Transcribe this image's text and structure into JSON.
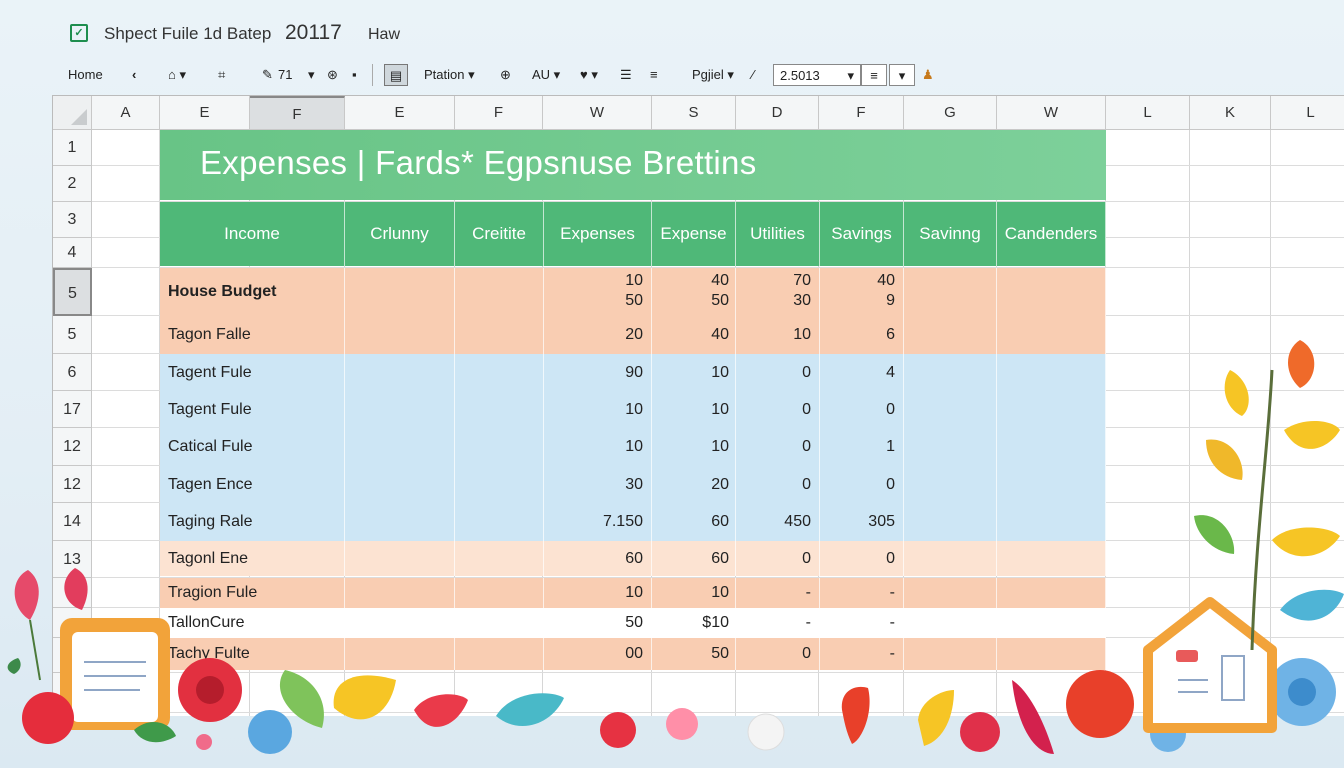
{
  "title": {
    "text": "Shpect  Fuile  1d  Batep",
    "year": "20117",
    "menu": "Haw"
  },
  "toolbar": {
    "home": "Home",
    "font_size": "71",
    "style": "Ptation",
    "align": "AU",
    "page": "Pgjiel",
    "zoom_value": "2.5013"
  },
  "column_headers": [
    "A",
    "E",
    "F",
    "E",
    "F",
    "W",
    "S",
    "D",
    "F",
    "G",
    "W",
    "L",
    "K",
    "L"
  ],
  "row_headers": [
    "1",
    "2",
    "3",
    "4",
    "5",
    "5",
    "6",
    "17",
    "12",
    "12",
    "14",
    "13",
    "",
    "",
    "",
    ""
  ],
  "banner": "Expenses  | Fards* Egpsnuse Brettins",
  "headers": [
    "Income",
    "Crlunny",
    "Creitite",
    "Expenses",
    "Expense",
    "Utilities",
    "Savings",
    "Savinng",
    "Candenders"
  ],
  "rows": [
    {
      "label": "House Budget",
      "bold": true,
      "values": [
        [
          "10",
          "50"
        ],
        [
          "40",
          "50"
        ],
        [
          "70",
          "30"
        ],
        [
          "40",
          "9"
        ]
      ]
    },
    {
      "label": "Tagon Falle",
      "values": [
        "20",
        "40",
        "10",
        "6"
      ]
    },
    {
      "label": "Tagent Fule",
      "values": [
        "90",
        "10",
        "0",
        "4"
      ]
    },
    {
      "label": "Tagent Fule",
      "values": [
        "10",
        "10",
        "0",
        "0"
      ]
    },
    {
      "label": "Catical Fule",
      "values": [
        "10",
        "10",
        "0",
        "1"
      ]
    },
    {
      "label": "Tagen Ence",
      "values": [
        "30",
        "20",
        "0",
        "0"
      ]
    },
    {
      "label": "Taging Rale",
      "values": [
        "7.150",
        "60",
        "450",
        "305"
      ]
    },
    {
      "label": "Tagonl Ene",
      "values": [
        "60",
        "60",
        "0",
        "0"
      ]
    },
    {
      "label": "Tragion Fule",
      "values": [
        "10",
        "10",
        "-",
        "-"
      ]
    },
    {
      "label": "TallonCure",
      "values": [
        "50",
        "$10",
        "-",
        "-"
      ]
    },
    {
      "label": "Tachy Fulte",
      "values": [
        "00",
        "50",
        "0",
        "-"
      ]
    }
  ],
  "colors": {
    "banner": "#6cc68a",
    "header": "#4fb878",
    "peach": "#f9cdb2",
    "blue": "#cde6f5",
    "light_peach": "#fce3d2"
  }
}
